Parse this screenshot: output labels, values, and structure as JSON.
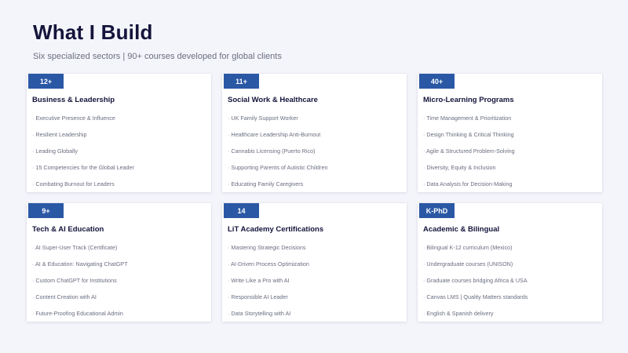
{
  "page": {
    "title": "What I Build",
    "subtitle": "Six specialized sectors | 90+ courses developed for global clients"
  },
  "colors": {
    "badge": "#2a58a5",
    "title": "#14143c",
    "muted": "#6a6e80",
    "background": "#f4f5fa"
  },
  "sectors": [
    {
      "badge": "12+",
      "title": "Business & Leadership",
      "items": [
        "Executive Presence & Influence",
        "Resilient Leadership",
        "Leading Globally",
        "15 Competencies for the Global Leader",
        "Combating Burnout for Leaders"
      ]
    },
    {
      "badge": "11+",
      "title": "Social Work & Healthcare",
      "items": [
        "UK Family Support Worker",
        "Healthcare Leadership Anti-Burnout",
        "Cannabis Licensing (Puerto Rico)",
        "Supporting Parents of Autistic Children",
        "Educating Family Caregivers"
      ]
    },
    {
      "badge": "40+",
      "title": "Micro-Learning Programs",
      "items": [
        "Time Management & Prioritization",
        "Design Thinking & Critical Thinking",
        "Agile & Structured Problem-Solving",
        "Diversity, Equity & Inclusion",
        "Data Analysis for Decision-Making"
      ]
    },
    {
      "badge": "9+",
      "title": "Tech & AI Education",
      "items": [
        "AI Super-User Track (Certificate)",
        "AI & Education: Navigating ChatGPT",
        "Custom ChatGPT for Institutions",
        "Content Creation with AI",
        "Future-Proofing Educational Admin"
      ]
    },
    {
      "badge": "14",
      "title": "LiT Academy Certifications",
      "items": [
        "Mastering Strategic Decisions",
        "AI-Driven Process Optimization",
        "Write Like a Pro with AI",
        "Responsible AI Leader",
        "Data Storytelling with AI"
      ]
    },
    {
      "badge": "K-PhD",
      "title": "Academic & Bilingual",
      "items": [
        "Bilingual K-12 curriculum (Mexico)",
        "Undergraduate courses (UNISON)",
        "Graduate courses bridging Africa & USA",
        "Canvas LMS | Quality Matters standards",
        "English & Spanish delivery"
      ]
    }
  ]
}
